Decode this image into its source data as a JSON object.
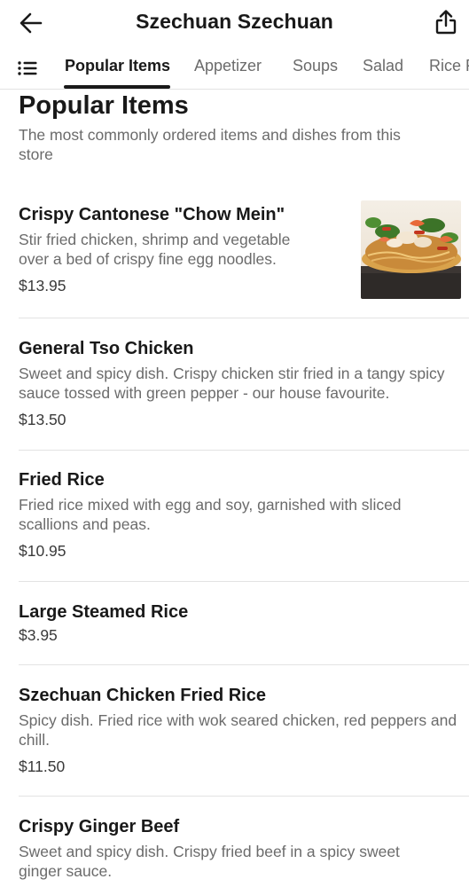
{
  "header": {
    "title": "Szechuan Szechuan",
    "back_icon": "arrow-left-icon",
    "share_icon": "share-icon"
  },
  "tabs": {
    "menu_icon": "list-icon",
    "items": [
      "Popular Items",
      "Appetizer",
      "Soups",
      "Salad",
      "Rice F"
    ],
    "active": "Popular Items"
  },
  "section": {
    "title": "Popular Items",
    "subtitle": "The most commonly ordered items and dishes from this store"
  },
  "menu_items": [
    {
      "name": "Crispy Cantonese \"Chow Mein\"",
      "description": "Stir fried chicken, shrimp and vegetable over a bed of crispy fine egg noodles.",
      "price": "$13.95",
      "has_image": true
    },
    {
      "name": "General Tso Chicken",
      "description": "Sweet and spicy dish. Crispy chicken stir fried in a tangy spicy sauce tossed with green pepper - our house favourite.",
      "price": "$13.50"
    },
    {
      "name": "Fried Rice",
      "description": "Fried rice mixed with egg and soy, garnished with sliced scallions and peas.",
      "price": "$10.95"
    },
    {
      "name": "Large Steamed Rice",
      "description": "",
      "price": "$3.95"
    },
    {
      "name": "Szechuan Chicken Fried Rice",
      "description": "Spicy dish. Fried rice with wok seared chicken, red peppers and chill.",
      "price": "$11.50"
    },
    {
      "name": "Crispy Ginger Beef",
      "description": "Sweet and spicy dish. Crispy fried beef in a spicy sweet ginger sauce.",
      "price": ""
    }
  ],
  "colors": {
    "text_primary": "#191919",
    "text_secondary": "#6b6b6b",
    "divider": "#e3e3e3",
    "background": "#ffffff"
  }
}
